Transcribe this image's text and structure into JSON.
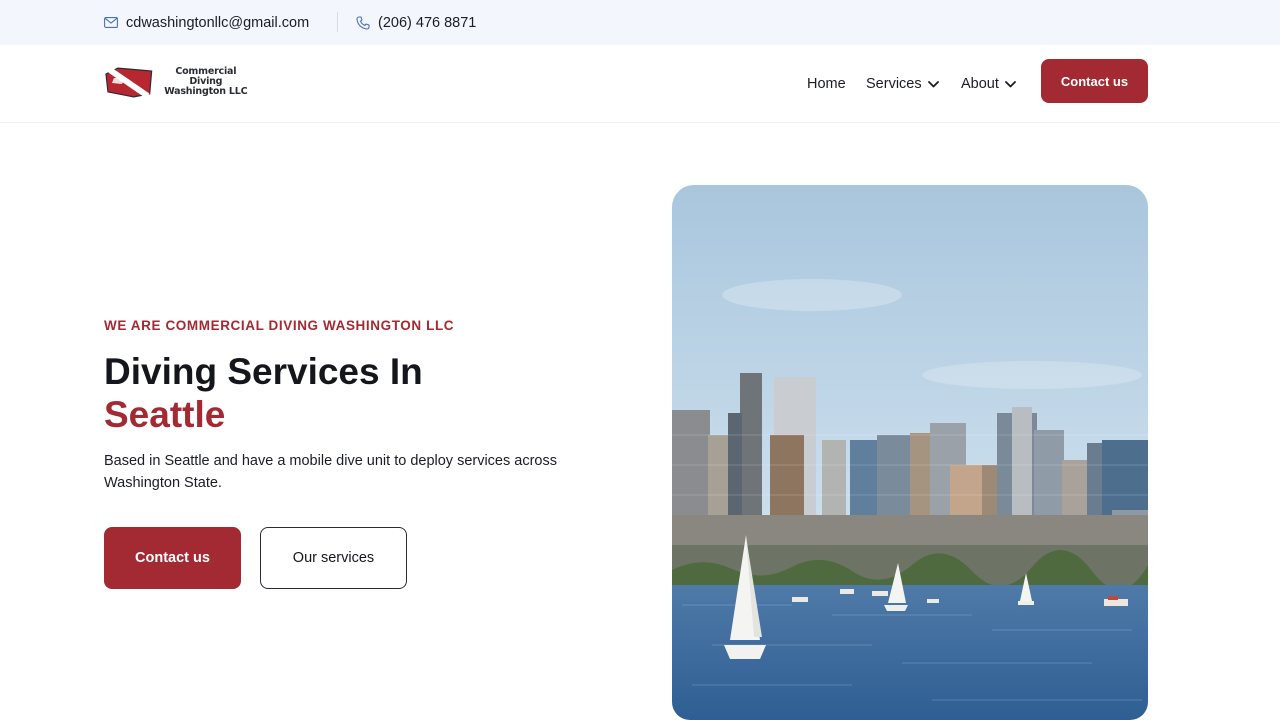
{
  "topbar": {
    "email": "cdwashingtonllc@gmail.com",
    "phone": "(206) 476 8871",
    "email_icon": "mail-icon",
    "phone_icon": "phone-icon"
  },
  "header": {
    "logo": {
      "line1": "Commercial Diving",
      "line2": "Washington LLC"
    },
    "nav": [
      {
        "label": "Home"
      },
      {
        "label": "Services",
        "has_dropdown": true
      },
      {
        "label": "About",
        "has_dropdown": true
      }
    ],
    "cta_label": "Contact us"
  },
  "hero": {
    "eyebrow": "WE ARE COMMERCIAL DIVING WASHINGTON LLC",
    "title_line1": "Diving Services In",
    "title_line2": "Seattle",
    "description": "Based in Seattle and have a mobile dive unit to deploy services across Washington State.",
    "primary_button": "Contact us",
    "secondary_button": "Our services"
  },
  "colors": {
    "accent": "#a32a33",
    "topbar_bg": "#f3f6fc",
    "text": "#14161c"
  }
}
